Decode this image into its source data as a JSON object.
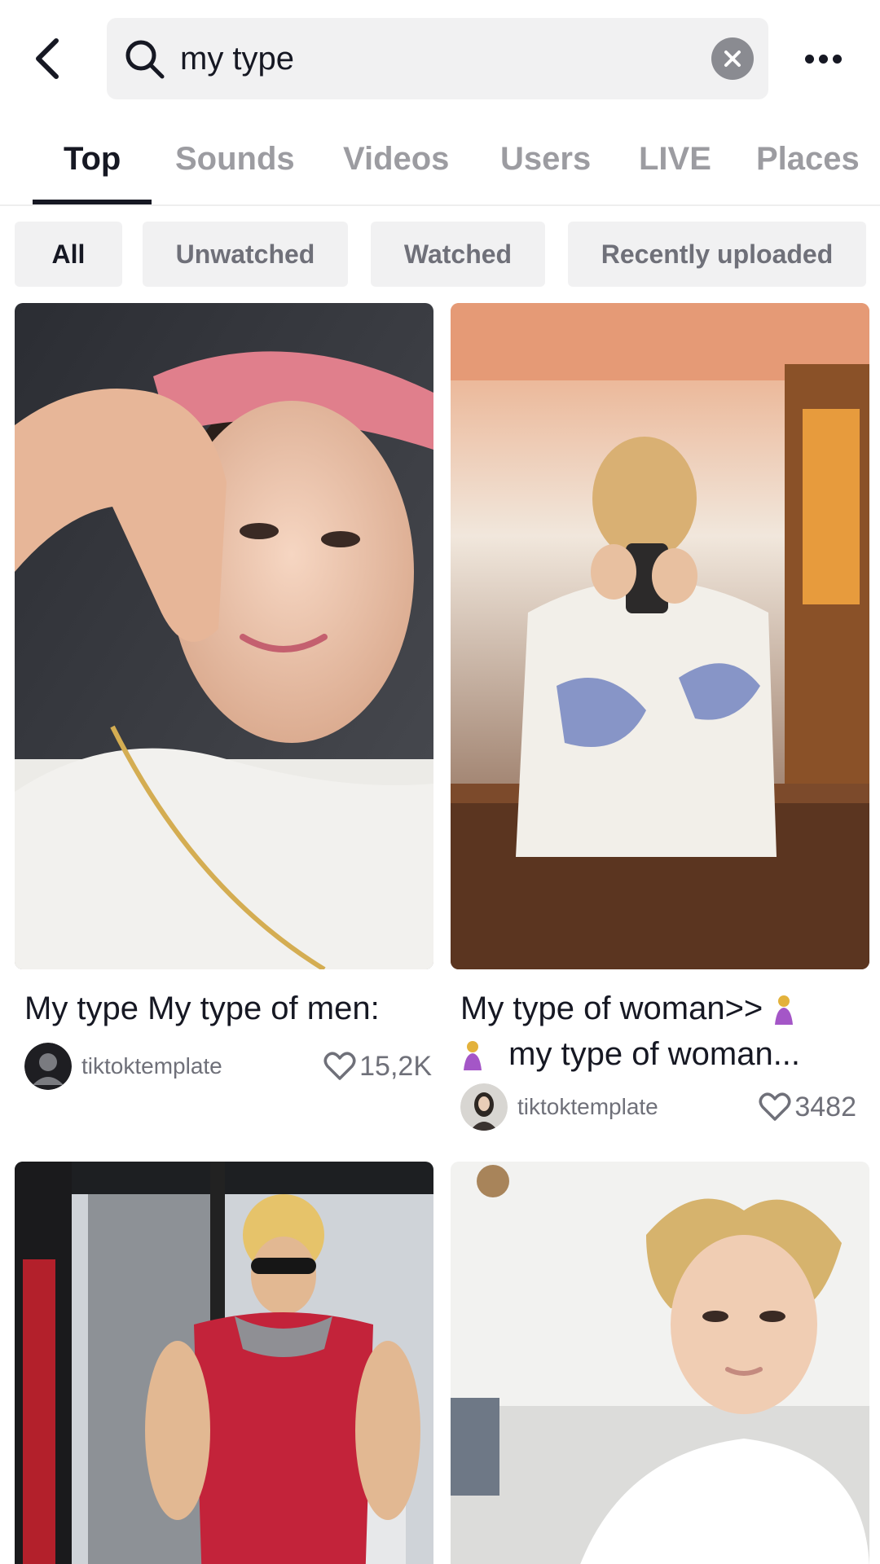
{
  "search": {
    "query": "my type"
  },
  "tabs": [
    {
      "label": "Top",
      "active": true
    },
    {
      "label": "Sounds",
      "active": false
    },
    {
      "label": "Videos",
      "active": false
    },
    {
      "label": "Users",
      "active": false
    },
    {
      "label": "LIVE",
      "active": false
    },
    {
      "label": "Places",
      "active": false
    }
  ],
  "filters": [
    {
      "label": "All",
      "active": true
    },
    {
      "label": "Unwatched",
      "active": false
    },
    {
      "label": "Watched",
      "active": false
    },
    {
      "label": "Recently uploaded",
      "active": false
    }
  ],
  "results": [
    {
      "caption": "My type My type of men:",
      "author": "tiktoktemplate",
      "likes": "15,2K"
    },
    {
      "caption_line1": "My type of woman>>",
      "caption_line2": "my type of woman...",
      "author": "tiktoktemplate",
      "likes": "3482"
    },
    {
      "caption": "",
      "author": "",
      "likes": ""
    },
    {
      "caption": "",
      "author": "",
      "likes": ""
    }
  ],
  "colors": {
    "text": "#161823",
    "muted": "#9c9ca1",
    "chip_bg": "#f1f1f2"
  },
  "icons": [
    "back-arrow-icon",
    "search-icon",
    "clear-icon",
    "more-icon",
    "heart-icon",
    "woman-emoji-icon"
  ]
}
